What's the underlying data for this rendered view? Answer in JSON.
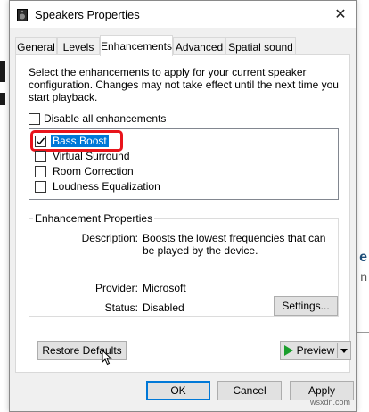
{
  "window": {
    "title": "Speakers Properties",
    "close_glyph": "✕"
  },
  "tabs": [
    {
      "label": "General",
      "active": false
    },
    {
      "label": "Levels",
      "active": false
    },
    {
      "label": "Enhancements",
      "active": true
    },
    {
      "label": "Advanced",
      "active": false
    },
    {
      "label": "Spatial sound",
      "active": false
    }
  ],
  "enhancements": {
    "description": "Select the enhancements to apply for your current speaker configuration. Changes may not take effect until the next time you start playback.",
    "disable_all_label": "Disable all enhancements",
    "disable_all_checked": false,
    "items": [
      {
        "label": "Bass Boost",
        "checked": true,
        "selected": true
      },
      {
        "label": "Virtual Surround",
        "checked": false,
        "selected": false
      },
      {
        "label": "Room Correction",
        "checked": false,
        "selected": false
      },
      {
        "label": "Loudness Equalization",
        "checked": false,
        "selected": false
      }
    ]
  },
  "properties": {
    "group_title": "Enhancement Properties",
    "description_label": "Description:",
    "description_value": "Boosts the lowest frequencies that can be played by the device.",
    "provider_label": "Provider:",
    "provider_value": "Microsoft",
    "status_label": "Status:",
    "status_value": "Disabled",
    "settings_label": "Settings..."
  },
  "buttons": {
    "restore_defaults": "Restore Defaults",
    "preview": "Preview",
    "ok": "OK",
    "cancel": "Cancel",
    "apply": "Apply"
  },
  "background": {
    "right_glyph_1": "e",
    "right_glyph_2": "n",
    "watermark": "wsxdn.com"
  },
  "colors": {
    "accent": "#0078d7",
    "highlight_red": "#e8141b",
    "preview_green": "#1a9e2c"
  }
}
